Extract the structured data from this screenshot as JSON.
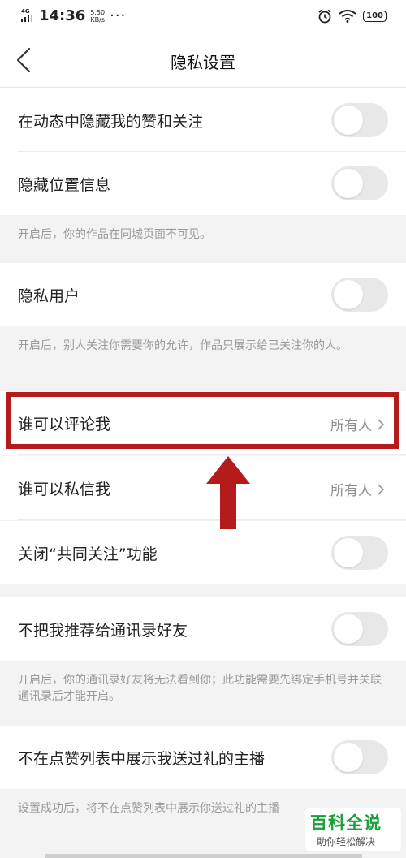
{
  "status_bar": {
    "network": "4G",
    "time": "14:36",
    "speed_value": "5.50",
    "speed_unit": "KB/s",
    "more": "···",
    "battery": "100"
  },
  "header": {
    "title": "隐私设置"
  },
  "settings": {
    "hide_likes_follows": {
      "label": "在动态中隐藏我的赞和关注",
      "enabled": false
    },
    "hide_location": {
      "label": "隐藏位置信息",
      "enabled": false
    },
    "hide_location_note": "开启后，你的作品在同城页面不可见。",
    "private_user": {
      "label": "隐私用户",
      "enabled": false
    },
    "private_user_note": "开启后，别人关注你需要你的允许，作品只展示给已关注你的人。",
    "who_can_comment": {
      "label": "谁可以评论我",
      "value": "所有人"
    },
    "who_can_message": {
      "label": "谁可以私信我",
      "value": "所有人"
    },
    "mutual_follow": {
      "label": "关闭“共同关注”功能",
      "enabled": false
    },
    "no_recommend_contacts": {
      "label": "不把我推荐给通讯录好友",
      "enabled": false
    },
    "no_recommend_contacts_note": "开启后，你的通讯录好友将无法看到你；此功能需要先绑定手机号并关联通讯录后才能开启。",
    "hide_gift_streamers": {
      "label": "不在点赞列表中展示我送过礼的主播",
      "enabled": false
    },
    "hide_gift_streamers_note": "设置成功后，将不在点赞列表中展示你送过礼的主播"
  },
  "watermark": {
    "title": "百科全说",
    "subtitle": "助你轻松解决"
  },
  "colors": {
    "annotation_red": "#b61b1b",
    "toggle_off": "#e8e8e8",
    "watermark_green": "#1a9f3c"
  }
}
